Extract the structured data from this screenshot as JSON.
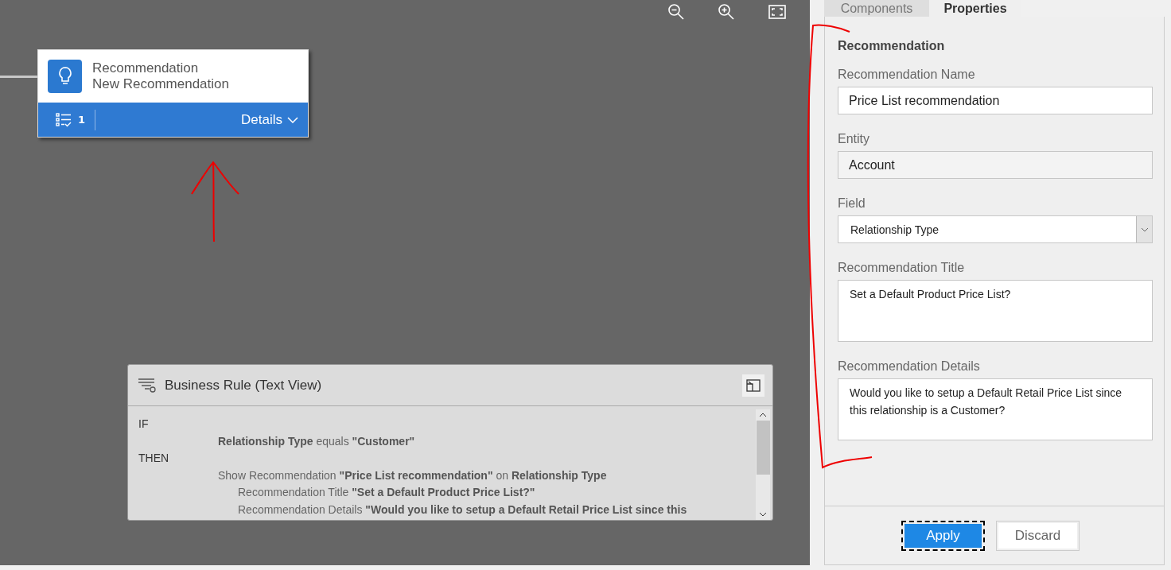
{
  "node": {
    "type": "Recommendation",
    "name": "New Recommendation",
    "count": "1",
    "details": "Details"
  },
  "rule_panel": {
    "title": "Business Rule (Text View)",
    "lines": [
      {
        "kind": "keyword",
        "text": "IF"
      },
      {
        "kind": "condition",
        "text": "**Relationship Type** equals **\"Customer\"**"
      },
      {
        "kind": "keyword",
        "text": "THEN"
      },
      {
        "kind": "condition",
        "text": "Show Recommendation **\"Price List recommendation\"** on **Relationship Type**"
      },
      {
        "kind": "detail",
        "text": "Recommendation Title **\"Set a Default Product Price List?\"**"
      },
      {
        "kind": "detail",
        "text": "Recommendation Details **\"Would you like to setup a Default Retail Price List since this**"
      }
    ]
  },
  "tabs": [
    {
      "label": "Components",
      "selected": false
    },
    {
      "label": "Properties",
      "selected": true
    }
  ],
  "properties": {
    "heading": "Recommendation",
    "fields": [
      {
        "kind": "text",
        "label": "Recommendation Name",
        "value": "Price List recommendation"
      },
      {
        "kind": "readonly",
        "label": "Entity",
        "value": "Account"
      },
      {
        "kind": "select",
        "label": "Field",
        "value": "Relationship Type"
      },
      {
        "kind": "textarea",
        "label": "Recommendation Title",
        "value": "Set a Default Product Price List?"
      },
      {
        "kind": "textarea",
        "label": "Recommendation Details",
        "value": "Would you like to setup a Default Retail Price List since this relationship is a Customer?"
      }
    ]
  },
  "buttons": [
    {
      "label": "Apply",
      "kind": "primary",
      "focused": true
    },
    {
      "label": "Discard",
      "kind": "secondary",
      "focused": false
    }
  ]
}
